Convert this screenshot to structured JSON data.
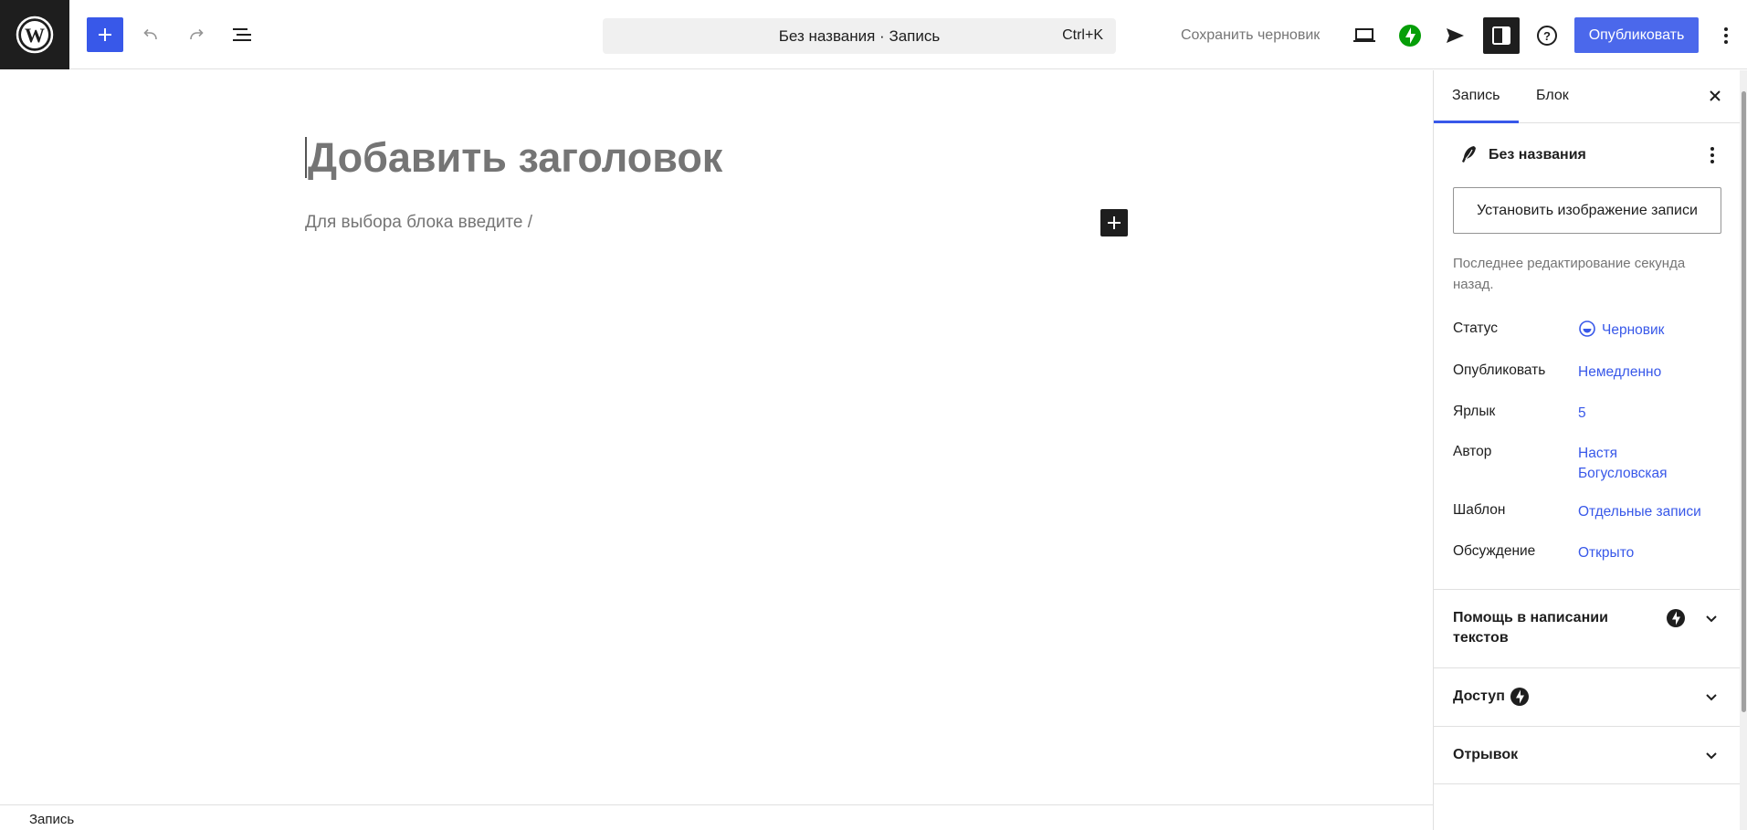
{
  "header": {
    "search_title": "Без названия · Запись",
    "search_shortcut": "Ctrl+K",
    "save_draft_label": "Сохранить черновик",
    "publish_label": "Опубликовать"
  },
  "editor": {
    "title_placeholder": "Добавить заголовок",
    "block_placeholder": "Для выбора блока введите /"
  },
  "footer": {
    "breadcrumb": "Запись"
  },
  "sidebar": {
    "tabs": [
      {
        "label": "Запись",
        "active": true
      },
      {
        "label": "Блок",
        "active": false
      }
    ],
    "post_title": "Без названия",
    "featured_image_button": "Установить изображение записи",
    "last_edited": "Последнее редактирование секунда назад.",
    "meta": [
      {
        "label": "Статус",
        "value": "Черновик"
      },
      {
        "label": "Опубликовать",
        "value": "Немедленно"
      },
      {
        "label": "Ярлык",
        "value": "5"
      },
      {
        "label": "Автор",
        "value": "Настя Богусловская"
      },
      {
        "label": "Шаблон",
        "value": "Отдельные записи"
      },
      {
        "label": "Обсуждение",
        "value": "Открыто"
      }
    ],
    "panels": [
      {
        "title": "Помощь в написании текстов"
      },
      {
        "title": "Доступ"
      },
      {
        "title": "Отрывок"
      }
    ]
  },
  "colors": {
    "accent": "#3858e9",
    "dark": "#1e1e1e",
    "jetpack_green": "#069e08",
    "muted": "#757575"
  }
}
